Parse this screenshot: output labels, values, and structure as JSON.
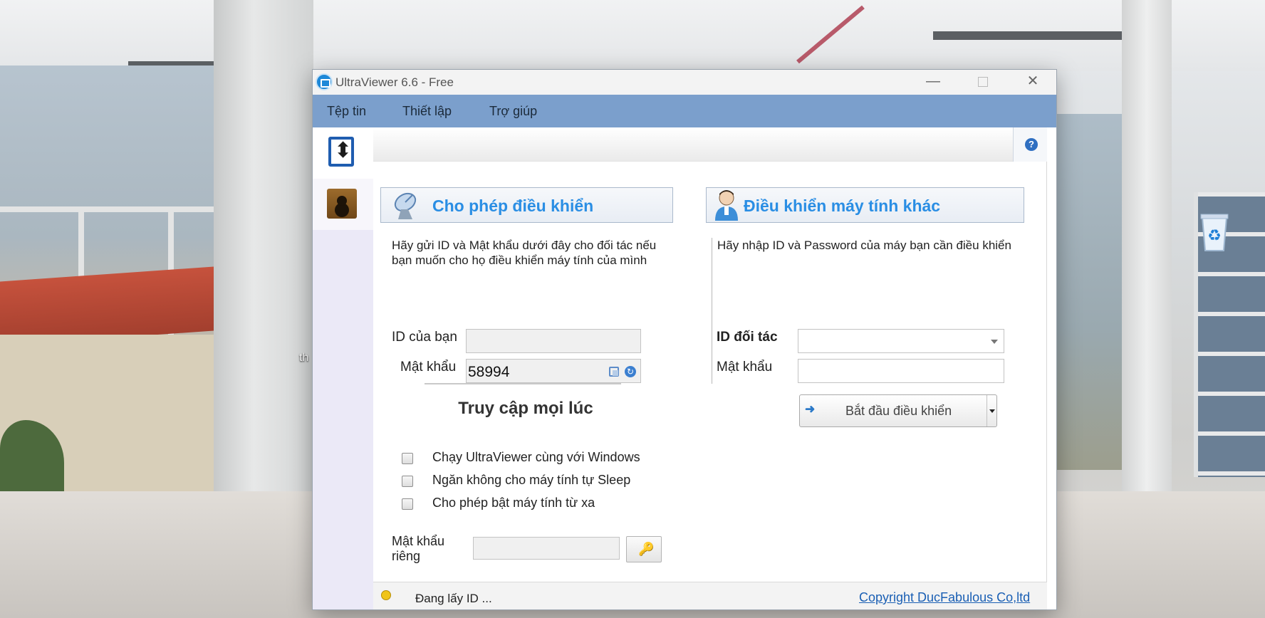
{
  "window": {
    "title": "UltraViewer 6.6 - Free",
    "controls": {
      "minimize": "—",
      "maximize": "",
      "close": "✕"
    }
  },
  "menu": {
    "items": [
      "Tệp tin",
      "Thiết lập",
      "Trợ giúp"
    ]
  },
  "sidebar": {
    "items": [
      {
        "icon": "transfer-arrows-icon",
        "active": true
      },
      {
        "icon": "contacts-book-icon",
        "active": false
      }
    ]
  },
  "help": {
    "icon": "help-icon",
    "glyph": "?"
  },
  "allow_control": {
    "title": "Cho phép điều khiển",
    "description": "Hãy gửi ID và Mật khẩu dưới đây cho đối tác nếu bạn muốn cho họ điều khiển máy tính của mình",
    "id_label": "ID của bạn",
    "id_value": "",
    "password_label": "Mật khẩu",
    "password_value": "58994"
  },
  "access_anytime": {
    "title": "Truy cập mọi lúc",
    "options": [
      {
        "label": "Chạy UltraViewer cùng với Windows",
        "checked": false
      },
      {
        "label": "Ngăn không cho máy tính tự Sleep",
        "checked": false
      },
      {
        "label": "Cho phép bật máy tính từ xa",
        "checked": false
      }
    ],
    "private_password_label": "Mật khẩu riêng",
    "private_password_value": ""
  },
  "remote_control": {
    "title": "Điều khiển máy tính khác",
    "description": "Hãy nhập ID và Password của máy bạn cần điều khiển",
    "partner_id_label": "ID đối tác",
    "partner_id_value": "",
    "password_label": "Mật khẩu",
    "password_value": "",
    "start_button": "Bắt đầu điều khiển",
    "start_arrow": "➜"
  },
  "status": {
    "text": "Đang lấy ID ...",
    "copyright": "Copyright DucFabulous Co,ltd",
    "indicator_color": "#f0c419"
  },
  "desktop": {
    "icon_label": "th"
  }
}
